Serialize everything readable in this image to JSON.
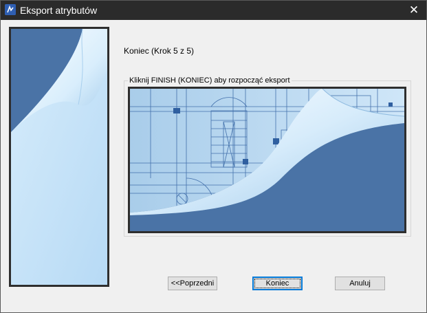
{
  "window": {
    "title": "Eksport atrybutów",
    "close_glyph": "✕"
  },
  "wizard": {
    "step_label": "Koniec (Krok 5 z 5)",
    "instruction": "Kliknij FINISH (KONIEC) aby rozpocząć eksport"
  },
  "buttons": {
    "back_label": "<<Poprzedni",
    "finish_label": "Koniec",
    "cancel_label": "Anuluj"
  },
  "colors": {
    "titlebar": "#2b2b2b",
    "page_blue": "#4a73a6",
    "page_light": "#c9e4f8",
    "blueprint_line": "#2f5fa0"
  },
  "icons": {
    "app": "app-icon",
    "close": "close-icon"
  }
}
